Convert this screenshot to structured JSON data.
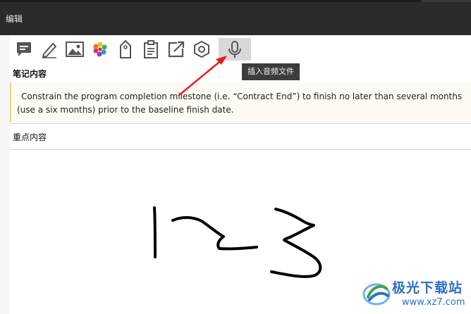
{
  "window": {
    "title": "编辑"
  },
  "toolbar": {
    "tools": [
      {
        "icon": "comment-icon",
        "active": false
      },
      {
        "icon": "pen-icon",
        "active": false
      },
      {
        "icon": "image-icon",
        "active": false
      },
      {
        "icon": "color-palette-icon",
        "active": false
      },
      {
        "icon": "tag-icon",
        "active": false
      },
      {
        "icon": "clipboard-icon",
        "active": false
      },
      {
        "icon": "export-icon",
        "active": false
      },
      {
        "icon": "hexagon-settings-icon",
        "active": false
      },
      {
        "icon": "microphone-icon",
        "active": true
      }
    ],
    "tooltip": "插入音频文件"
  },
  "notes": {
    "label": "笔记内容",
    "text": "Constrain the program completion milestone (i.e. “Contract End”) to finish no later than several months (use a six months) prior to the baseline finish date."
  },
  "key_content": {
    "label": "重点内容"
  },
  "colors": {
    "titlebar": "#2b2b2b",
    "annotation_arrow": "#e02020",
    "note_border": "#f5d06b",
    "watermark": "#2f6fc7"
  },
  "watermark": {
    "brand": "极光下载站",
    "url": "www.xz7.com"
  }
}
